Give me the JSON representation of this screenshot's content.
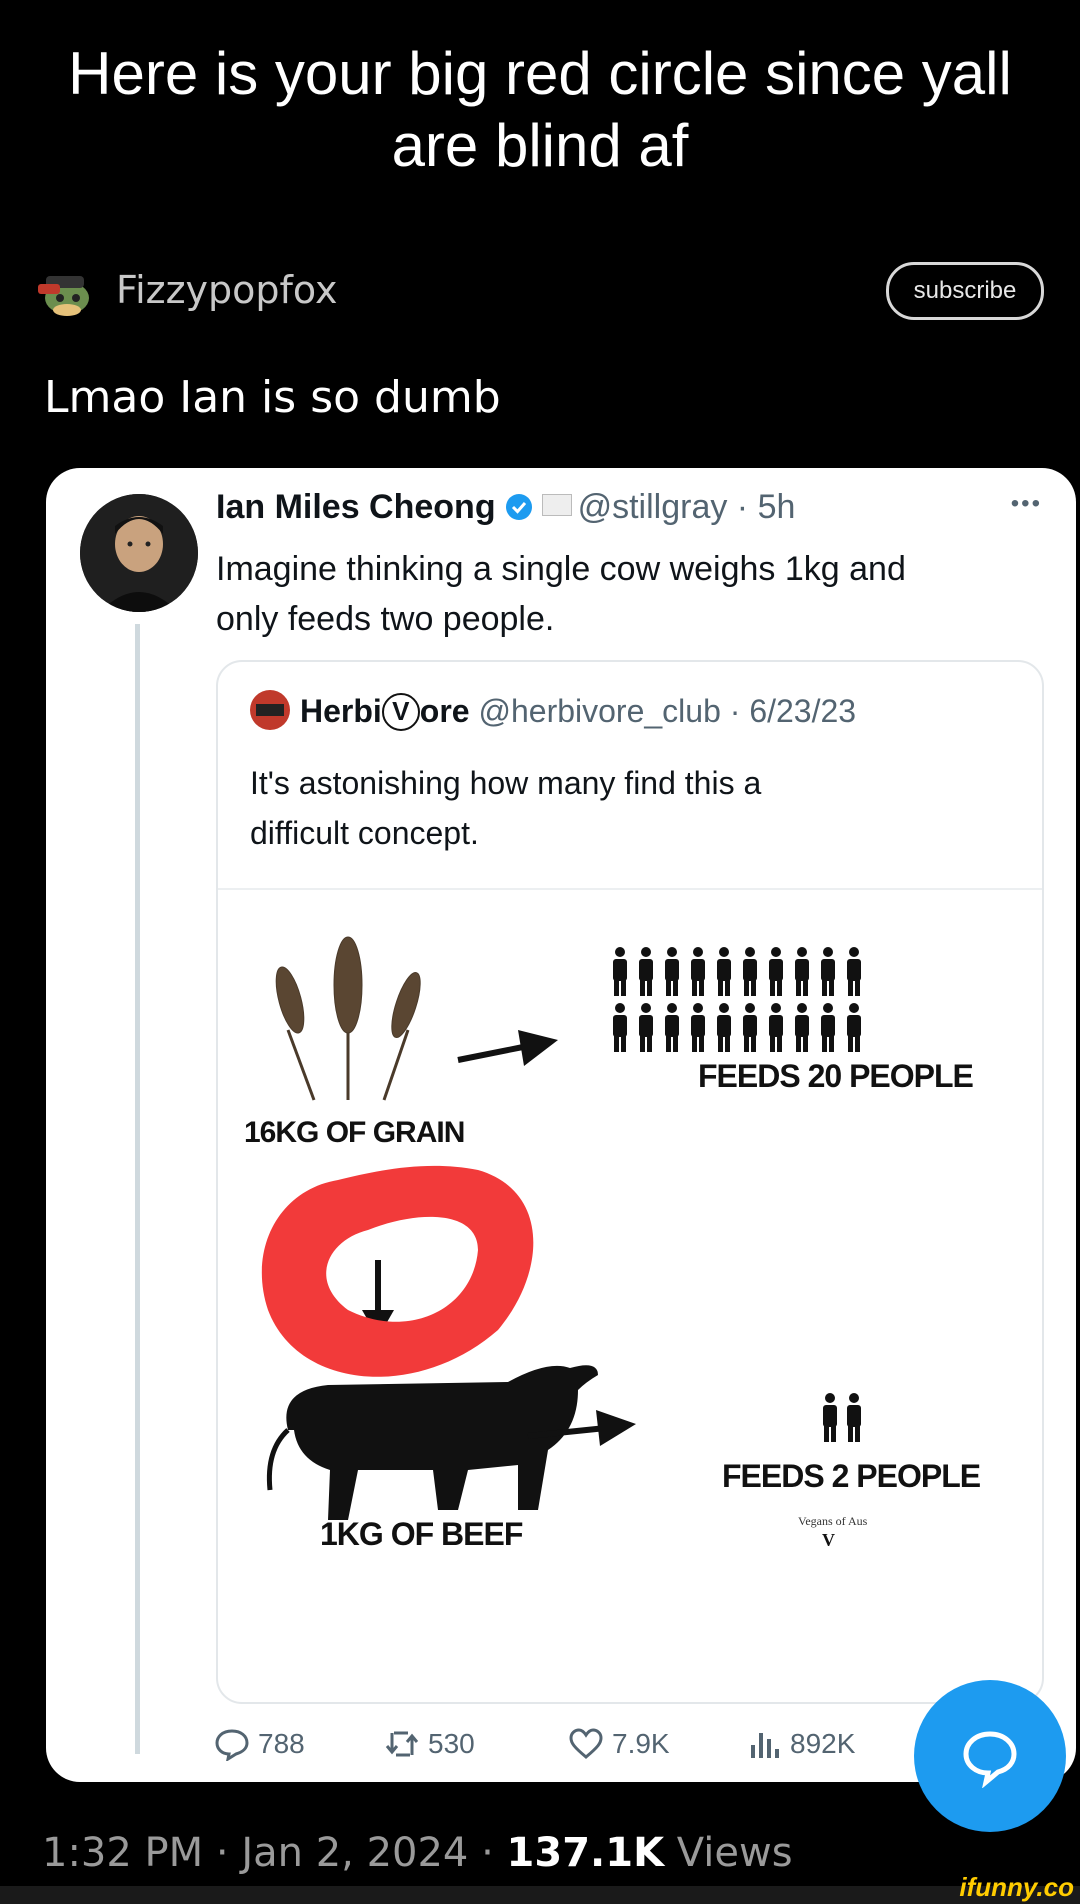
{
  "meme": {
    "caption_line1": "Here is your big red circle since yall",
    "caption_line2": "are blind af"
  },
  "post": {
    "username": "Fizzypopfox",
    "subscribe_label": "subscribe",
    "text": "Lmao Ian is so dumb"
  },
  "tweet": {
    "author_name": "Ian Miles Cheong",
    "handle": "@stillgray",
    "age": "5h",
    "more": "•••",
    "text_line1": "Imagine thinking a single cow weighs 1kg and",
    "text_line2": "only feeds two people.",
    "quote": {
      "author_name_a": "Herbi",
      "author_name_v": "V",
      "author_name_b": "ore",
      "handle": "@herbivore_club",
      "date": "6/23/23",
      "text_line1": "It's astonishing how many find this a",
      "text_line2": "difficult concept.",
      "infographic": {
        "grain_label": "16KG OF GRAIN",
        "grain_feeds": "FEEDS 20 PEOPLE",
        "beef_label": "1KG OF BEEF",
        "beef_feeds": "FEEDS 2 PEOPLE",
        "credit": "Vegans of Aus",
        "credit_logo": "V"
      }
    },
    "metrics": {
      "replies": "788",
      "retweets": "530",
      "likes": "7.9K",
      "views": "892K"
    }
  },
  "footer": {
    "time": "1:32 PM",
    "date": "Jan 2, 2024",
    "views_count": "137.1K",
    "views_label": "Views"
  },
  "watermark": "ifunny.co",
  "colors": {
    "accent_blue": "#1d9bf0",
    "circle_red": "#f23a3a",
    "verified": "#1d9bf0"
  }
}
